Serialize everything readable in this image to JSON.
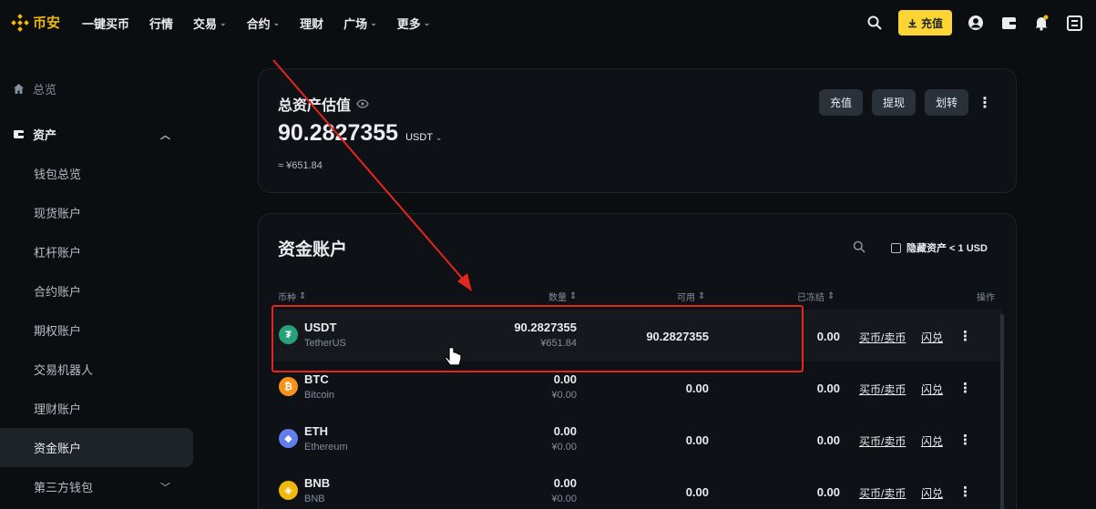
{
  "nav": {
    "logo_text": "币安",
    "items": [
      {
        "label": "一键买币",
        "has_chevron": false
      },
      {
        "label": "行情",
        "has_chevron": false
      },
      {
        "label": "交易",
        "has_chevron": true
      },
      {
        "label": "合约",
        "has_chevron": true
      },
      {
        "label": "理财",
        "has_chevron": false
      },
      {
        "label": "广场",
        "has_chevron": true
      },
      {
        "label": "更多",
        "has_chevron": true
      }
    ],
    "deposit_label": "充值",
    "right_icons": [
      "search-icon",
      "user-icon",
      "wallet-icon",
      "bell-icon",
      "settings-icon"
    ]
  },
  "sidebar": {
    "overview": "总览",
    "assets": "资产",
    "sub_items": [
      "钱包总览",
      "现货账户",
      "杠杆账户",
      "合约账户",
      "期权账户",
      "交易机器人",
      "理财账户",
      "资金账户"
    ],
    "active_index": 7,
    "third_party": "第三方钱包"
  },
  "total": {
    "title": "总资产估值",
    "amount": "90.2827355",
    "currency": "USDT",
    "cny": "≈ ¥651.84",
    "buttons": [
      "充值",
      "提现",
      "划转"
    ]
  },
  "funding": {
    "title": "资金账户",
    "hide_small": "隐藏资产 < 1 USD",
    "columns": {
      "coin": "币种",
      "quantity": "数量",
      "available": "可用",
      "frozen": "已冻结",
      "action": "操作"
    },
    "rows": [
      {
        "symbol": "USDT",
        "name": "TetherUS",
        "qty": "90.2827355",
        "qty_cny": "¥651.84",
        "available": "90.2827355",
        "frozen": "0.00",
        "buy": "买币/卖币",
        "convert": "闪兑",
        "color": "#26a17b",
        "glyph": "₮"
      },
      {
        "symbol": "BTC",
        "name": "Bitcoin",
        "qty": "0.00",
        "qty_cny": "¥0.00",
        "available": "0.00",
        "frozen": "0.00",
        "buy": "买币/卖币",
        "convert": "闪兑",
        "color": "#f7931a",
        "glyph": "₿"
      },
      {
        "symbol": "ETH",
        "name": "Ethereum",
        "qty": "0.00",
        "qty_cny": "¥0.00",
        "available": "0.00",
        "frozen": "0.00",
        "buy": "买币/卖币",
        "convert": "闪兑",
        "color": "#627eea",
        "glyph": "◆"
      },
      {
        "symbol": "BNB",
        "name": "BNB",
        "qty": "0.00",
        "qty_cny": "¥0.00",
        "available": "0.00",
        "frozen": "0.00",
        "buy": "买币/卖币",
        "convert": "闪兑",
        "color": "#f0b90b",
        "glyph": "◈"
      }
    ]
  }
}
